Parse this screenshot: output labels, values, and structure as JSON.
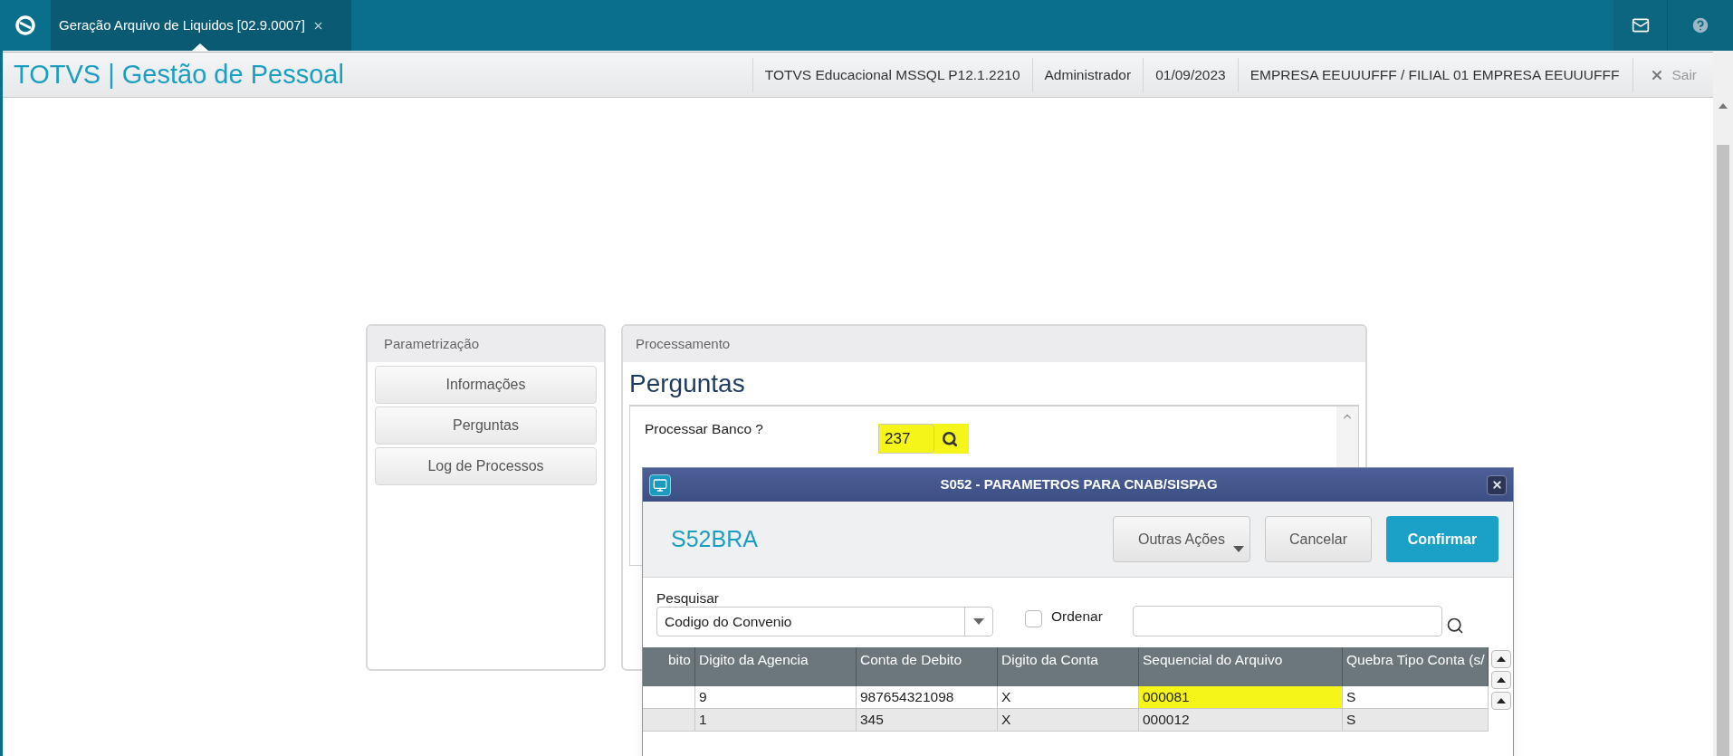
{
  "top_bar": {
    "tab": {
      "title": "Geração Arquivo de Liquidos [02.9.0007]",
      "selected": true
    }
  },
  "header": {
    "title": "TOTVS | Gestão de Pessoal",
    "info": [
      "TOTVS Educacional MSSQL P12.1.2210",
      "Administrador",
      "01/09/2023",
      "EMPRESA EEUUUFFF / FILIAL 01 EMPRESA EEUUUFFF"
    ],
    "exit": "Sair"
  },
  "parametrizacao": {
    "title": "Parametrização",
    "buttons": [
      "Informações",
      "Perguntas",
      "Log de Processos"
    ]
  },
  "processamento": {
    "title": "Processamento",
    "heading": "Perguntas",
    "question": {
      "label": "Processar Banco ?",
      "value": "237",
      "highlighted": true
    }
  },
  "dialog": {
    "title": "S052 - PARAMETROS PARA CNAB/SISPAG",
    "name": "S52BRA",
    "buttons": [
      {
        "label": "Outras Ações",
        "kind": "menu"
      },
      {
        "label": "Cancelar",
        "kind": "plain"
      },
      {
        "label": "Confirmar",
        "kind": "primary"
      }
    ],
    "search": {
      "label": "Pesquisar",
      "select_value": "Codigo do Convenio",
      "order_label": "Ordenar",
      "order_checked": false
    },
    "table": {
      "columns": [
        "bito",
        "Digito da Agencia",
        "Conta de Debito",
        "Digito da Conta",
        "Sequencial do Arquivo",
        "Quebra Tipo Conta (s/"
      ],
      "rows": [
        {
          "cells": [
            {
              "text": "",
              "highlighted": false
            },
            {
              "text": "9",
              "highlighted": false
            },
            {
              "text": "987654321098",
              "highlighted": false
            },
            {
              "text": "X",
              "highlighted": false
            },
            {
              "text": "000081",
              "highlighted": true
            },
            {
              "text": "S",
              "highlighted": false
            }
          ]
        },
        {
          "cells": [
            {
              "text": "",
              "highlighted": false
            },
            {
              "text": "1",
              "highlighted": false
            },
            {
              "text": "345",
              "highlighted": false
            },
            {
              "text": "X",
              "highlighted": false
            },
            {
              "text": "000012",
              "highlighted": false
            },
            {
              "text": "S",
              "highlighted": false
            }
          ]
        }
      ]
    }
  }
}
